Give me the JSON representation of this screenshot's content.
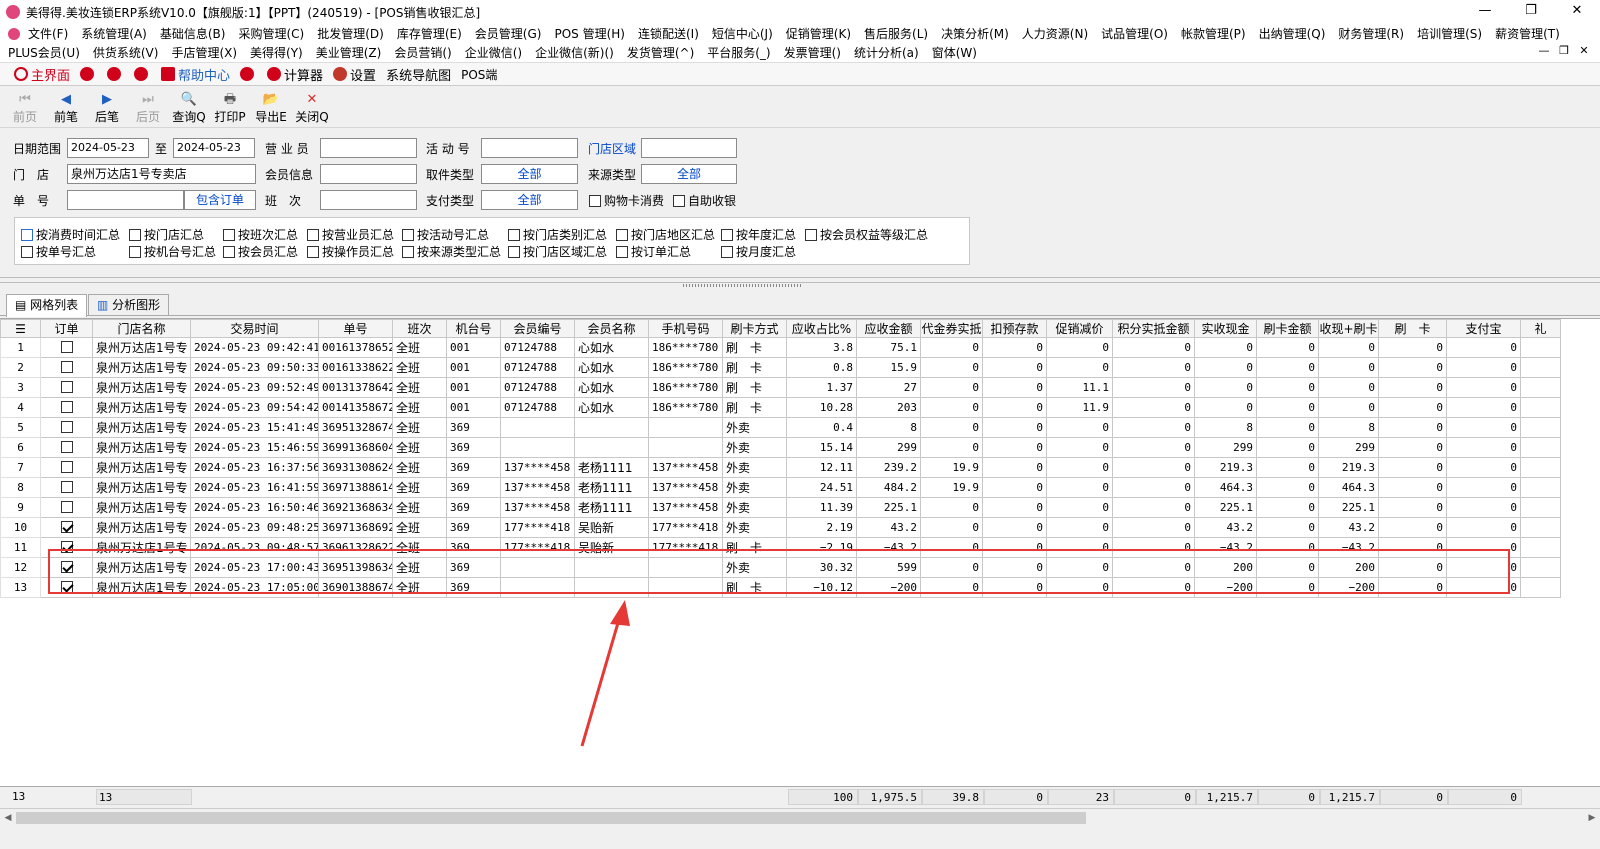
{
  "window": {
    "title": "美得得.美妆连锁ERP系统V10.0【旗舰版:1】【PPT】(240519) - [POS销售收银汇总]",
    "min": "—",
    "max": "❐",
    "close": "✕"
  },
  "menu_row1": [
    "文件(F)",
    "系统管理(A)",
    "基础信息(B)",
    "采购管理(C)",
    "批发管理(D)",
    "库存管理(E)",
    "会员管理(G)",
    "POS 管理(H)",
    "连锁配送(I)",
    "短信中心(J)",
    "促销管理(K)",
    "售后服务(L)",
    "决策分析(M)",
    "人力资源(N)",
    "试品管理(O)",
    "帐款管理(P)",
    "出纳管理(Q)",
    "财务管理(R)",
    "培训管理(S)",
    "薪资管理(T)"
  ],
  "menu_row2": [
    "PLUS会员(U)",
    "供货系统(V)",
    "手店管理(X)",
    "美得得(Y)",
    "美业管理(Z)",
    "会员营销()",
    "企业微信()",
    "企业微信(新)()",
    "发货管理(^)",
    "平台服务(_)",
    "发票管理()",
    "统计分析(a)",
    "窗体(W)"
  ],
  "mdi_controls": [
    "—",
    "❐",
    "✕"
  ],
  "quickbar": {
    "main": "主界面",
    "help": "帮助中心",
    "calc": "计算器",
    "settings": "设置",
    "nav": "系统导航图",
    "pos": "POS端"
  },
  "toolbar": [
    {
      "label": "前页",
      "icon": "⏮",
      "disabled": true
    },
    {
      "label": "前笔",
      "icon": "◀",
      "disabled": false
    },
    {
      "label": "后笔",
      "icon": "▶",
      "disabled": false
    },
    {
      "label": "后页",
      "icon": "⏭",
      "disabled": true
    },
    {
      "label": "查询Q",
      "icon": "🔍",
      "disabled": false
    },
    {
      "label": "打印P",
      "icon": "🖶",
      "disabled": false
    },
    {
      "label": "导出E",
      "icon": "📂",
      "disabled": false
    },
    {
      "label": "关闭Q",
      "icon": "✕",
      "disabled": false
    }
  ],
  "filter": {
    "date_label": "日期范围",
    "date_from": "2024-05-23",
    "to_label": "至",
    "date_to": "2024-05-23",
    "salesman_label": "营 业 员",
    "activity_label": "活 动 号",
    "region_label": "门店区域",
    "store_label": "门　店",
    "store_value": "泉州万达店1号专卖店",
    "member_label": "会员信息",
    "pickup_label": "取件类型",
    "pickup_value": "全部",
    "source_label": "来源类型",
    "source_value": "全部",
    "order_label": "单　号",
    "include_order": "包含订单",
    "shift_label": "班　次",
    "pay_label": "支付类型",
    "pay_value": "全部",
    "card_consume": "购物卡消费",
    "self_checkout": "自助收银"
  },
  "summary_options": {
    "row1": [
      "按消费时间汇总",
      "按门店汇总",
      "按班次汇总",
      "按营业员汇总",
      "按活动号汇总",
      "按门店类别汇总",
      "按门店地区汇总",
      "按年度汇总",
      "按会员权益等级汇总"
    ],
    "row2": [
      "按单号汇总",
      "按机台号汇总",
      "按会员汇总",
      "按操作员汇总",
      "按来源类型汇总",
      "按门店区域汇总",
      "按订单汇总",
      "按月度汇总"
    ]
  },
  "tabs": [
    "网格列表",
    "分析图形"
  ],
  "table": {
    "columns": [
      "订单",
      "门店名称",
      "交易时间",
      "单号",
      "班次",
      "机台号",
      "会员编号",
      "会员名称",
      "手机号码",
      "刷卡方式",
      "应收占比%",
      "应收金额",
      "代金券实抵",
      "扣预存款",
      "促销减价",
      "积分实抵金额",
      "实收现金",
      "刷卡金额",
      "收现+刷卡",
      "刷　卡",
      "支付宝",
      "礼"
    ],
    "rows": [
      {
        "n": "1",
        "checked": false,
        "store": "泉州万达店1号专",
        "time": "2024-05-23  09:42:41",
        "no": "00161378652",
        "shift": "全班",
        "pos": "001",
        "mno": "07124788",
        "mname": "心如水",
        "phone": "186****780",
        "pay": "刷　卡",
        "pct": "3.8",
        "amt": "75.1",
        "coupon": "0",
        "prepay": "0",
        "promo": "0",
        "points": "0",
        "cash": "0",
        "card": "0",
        "cashcard": "0",
        "swipe": "0",
        "alipay": "0",
        "gift": ""
      },
      {
        "n": "2",
        "checked": false,
        "store": "泉州万达店1号专",
        "time": "2024-05-23  09:50:33",
        "no": "00161338622",
        "shift": "全班",
        "pos": "001",
        "mno": "07124788",
        "mname": "心如水",
        "phone": "186****780",
        "pay": "刷　卡",
        "pct": "0.8",
        "amt": "15.9",
        "coupon": "0",
        "prepay": "0",
        "promo": "0",
        "points": "0",
        "cash": "0",
        "card": "0",
        "cashcard": "0",
        "swipe": "0",
        "alipay": "0",
        "gift": ""
      },
      {
        "n": "3",
        "checked": false,
        "store": "泉州万达店1号专",
        "time": "2024-05-23  09:52:49",
        "no": "00131378642",
        "shift": "全班",
        "pos": "001",
        "mno": "07124788",
        "mname": "心如水",
        "phone": "186****780",
        "pay": "刷　卡",
        "pct": "1.37",
        "amt": "27",
        "coupon": "0",
        "prepay": "0",
        "promo": "11.1",
        "points": "0",
        "cash": "0",
        "card": "0",
        "cashcard": "0",
        "swipe": "0",
        "alipay": "0",
        "gift": ""
      },
      {
        "n": "4",
        "checked": false,
        "store": "泉州万达店1号专",
        "time": "2024-05-23  09:54:42",
        "no": "00141358672",
        "shift": "全班",
        "pos": "001",
        "mno": "07124788",
        "mname": "心如水",
        "phone": "186****780",
        "pay": "刷　卡",
        "pct": "10.28",
        "amt": "203",
        "coupon": "0",
        "prepay": "0",
        "promo": "11.9",
        "points": "0",
        "cash": "0",
        "card": "0",
        "cashcard": "0",
        "swipe": "0",
        "alipay": "0",
        "gift": ""
      },
      {
        "n": "5",
        "checked": false,
        "store": "泉州万达店1号专",
        "time": "2024-05-23  15:41:49",
        "no": "36951328674",
        "shift": "全班",
        "pos": "369",
        "mno": "",
        "mname": "",
        "phone": "",
        "pay": "外卖",
        "pct": "0.4",
        "amt": "8",
        "coupon": "0",
        "prepay": "0",
        "promo": "0",
        "points": "0",
        "cash": "8",
        "card": "0",
        "cashcard": "8",
        "swipe": "0",
        "alipay": "0",
        "gift": ""
      },
      {
        "n": "6",
        "checked": false,
        "store": "泉州万达店1号专",
        "time": "2024-05-23  15:46:59",
        "no": "36991368604",
        "shift": "全班",
        "pos": "369",
        "mno": "",
        "mname": "",
        "phone": "",
        "pay": "外卖",
        "pct": "15.14",
        "amt": "299",
        "coupon": "0",
        "prepay": "0",
        "promo": "0",
        "points": "0",
        "cash": "299",
        "card": "0",
        "cashcard": "299",
        "swipe": "0",
        "alipay": "0",
        "gift": ""
      },
      {
        "n": "7",
        "checked": false,
        "store": "泉州万达店1号专",
        "time": "2024-05-23  16:37:56",
        "no": "36931308624",
        "shift": "全班",
        "pos": "369",
        "mno": "137****458",
        "mname": "老杨1111",
        "phone": "137****458",
        "pay": "外卖",
        "pct": "12.11",
        "amt": "239.2",
        "coupon": "19.9",
        "prepay": "0",
        "promo": "0",
        "points": "0",
        "cash": "219.3",
        "card": "0",
        "cashcard": "219.3",
        "swipe": "0",
        "alipay": "0",
        "gift": ""
      },
      {
        "n": "8",
        "checked": false,
        "store": "泉州万达店1号专",
        "time": "2024-05-23  16:41:59",
        "no": "36971388614",
        "shift": "全班",
        "pos": "369",
        "mno": "137****458",
        "mname": "老杨1111",
        "phone": "137****458",
        "pay": "外卖",
        "pct": "24.51",
        "amt": "484.2",
        "coupon": "19.9",
        "prepay": "0",
        "promo": "0",
        "points": "0",
        "cash": "464.3",
        "card": "0",
        "cashcard": "464.3",
        "swipe": "0",
        "alipay": "0",
        "gift": ""
      },
      {
        "n": "9",
        "checked": false,
        "store": "泉州万达店1号专",
        "time": "2024-05-23  16:50:46",
        "no": "36921368634",
        "shift": "全班",
        "pos": "369",
        "mno": "137****458",
        "mname": "老杨1111",
        "phone": "137****458",
        "pay": "外卖",
        "pct": "11.39",
        "amt": "225.1",
        "coupon": "0",
        "prepay": "0",
        "promo": "0",
        "points": "0",
        "cash": "225.1",
        "card": "0",
        "cashcard": "225.1",
        "swipe": "0",
        "alipay": "0",
        "gift": ""
      },
      {
        "n": "10",
        "checked": true,
        "store": "泉州万达店1号专",
        "time": "2024-05-23  09:48:25",
        "no": "36971368692",
        "shift": "全班",
        "pos": "369",
        "mno": "177****418",
        "mname": "吴贻新",
        "phone": "177****418",
        "pay": "外卖",
        "pct": "2.19",
        "amt": "43.2",
        "coupon": "0",
        "prepay": "0",
        "promo": "0",
        "points": "0",
        "cash": "43.2",
        "card": "0",
        "cashcard": "43.2",
        "swipe": "0",
        "alipay": "0",
        "gift": ""
      },
      {
        "n": "11",
        "checked": true,
        "store": "泉州万达店1号专",
        "time": "2024-05-23  09:48:57",
        "no": "36961328622",
        "shift": "全班",
        "pos": "369",
        "mno": "177****418",
        "mname": "吴贻新",
        "phone": "177****418",
        "pay": "刷　卡",
        "pct": "−2.19",
        "amt": "−43.2",
        "coupon": "0",
        "prepay": "0",
        "promo": "0",
        "points": "0",
        "cash": "−43.2",
        "card": "0",
        "cashcard": "−43.2",
        "swipe": "0",
        "alipay": "0",
        "gift": ""
      },
      {
        "n": "12",
        "checked": true,
        "store": "泉州万达店1号专",
        "time": "2024-05-23  17:00:43",
        "no": "36951398634",
        "shift": "全班",
        "pos": "369",
        "mno": "",
        "mname": "",
        "phone": "",
        "pay": "外卖",
        "pct": "30.32",
        "amt": "599",
        "coupon": "0",
        "prepay": "0",
        "promo": "0",
        "points": "0",
        "cash": "200",
        "card": "0",
        "cashcard": "200",
        "swipe": "0",
        "alipay": "0",
        "gift": ""
      },
      {
        "n": "13",
        "checked": true,
        "store": "泉州万达店1号专",
        "time": "2024-05-23  17:05:00",
        "no": "36901388674",
        "shift": "全班",
        "pos": "369",
        "mno": "",
        "mname": "",
        "phone": "",
        "pay": "刷　卡",
        "pct": "−10.12",
        "amt": "−200",
        "coupon": "0",
        "prepay": "0",
        "promo": "0",
        "points": "0",
        "cash": "−200",
        "card": "0",
        "cashcard": "−200",
        "swipe": "0",
        "alipay": "0",
        "gift": ""
      }
    ]
  },
  "footer": {
    "count": "13",
    "count2": "13",
    "pct": "100",
    "amt": "1,975.5",
    "coupon": "39.8",
    "prepay": "0",
    "promo": "23",
    "points": "0",
    "cash": "1,215.7",
    "card": "0",
    "cashcard": "1,215.7",
    "swipe": "0",
    "alipay": "0"
  },
  "colors": {
    "highlight": "#e53935",
    "link": "#0047c9"
  }
}
